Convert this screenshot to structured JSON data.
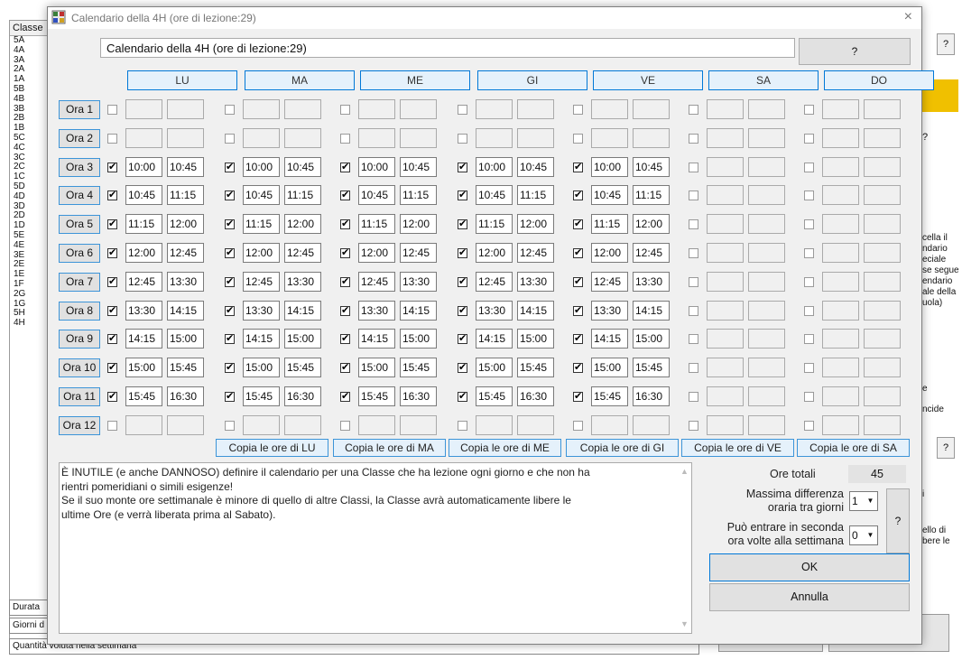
{
  "background": {
    "left_panel_header": "Classe",
    "classes": [
      "5A",
      "4A",
      "3A",
      "2A",
      "1A",
      "5B",
      "4B",
      "3B",
      "2B",
      "1B",
      "5C",
      "4C",
      "3C",
      "2C",
      "1C",
      "5D",
      "4D",
      "3D",
      "2D",
      "1D",
      "5E",
      "4E",
      "3E",
      "2E",
      "1E",
      "1F",
      "2G",
      "1G",
      "5H",
      "4H"
    ],
    "durata_label": "Durata",
    "giorni_label": "Giorni d",
    "quantita_label": "Quantità voluta nella settimana",
    "right_q1": "?",
    "right_q2": "?",
    "right_q3": "?",
    "right_text_lines": [
      "cella il",
      "ndario",
      "eciale",
      "se segue",
      "endario",
      "ale della",
      "uola)"
    ],
    "right_e": "e",
    "right_ncide": "ncide",
    "right_i": "i",
    "right_ello": "ello di",
    "right_bere": "bere le",
    "right_e2": "e",
    "accent_yellow": "#f0c000"
  },
  "dialog": {
    "title": "Calendario della 4H  (ore di lezione:29)",
    "close_glyph": "×",
    "calendar_label": "Calendario della 4H  (ore di lezione:29)",
    "help_label": "?",
    "days": [
      "LU",
      "MA",
      "ME",
      "GI",
      "VE",
      "SA",
      "DO"
    ],
    "hours": [
      {
        "label": "Ora 1",
        "checked": [
          false,
          false,
          false,
          false,
          false,
          false,
          false
        ],
        "start": "",
        "end": ""
      },
      {
        "label": "Ora 2",
        "checked": [
          false,
          false,
          false,
          false,
          false,
          false,
          false
        ],
        "start": "",
        "end": ""
      },
      {
        "label": "Ora 3",
        "checked": [
          true,
          true,
          true,
          true,
          true,
          false,
          false
        ],
        "start": "10:00",
        "end": "10:45"
      },
      {
        "label": "Ora 4",
        "checked": [
          true,
          true,
          true,
          true,
          true,
          false,
          false
        ],
        "start": "10:45",
        "end": "11:15"
      },
      {
        "label": "Ora 5",
        "checked": [
          true,
          true,
          true,
          true,
          true,
          false,
          false
        ],
        "start": "11:15",
        "end": "12:00"
      },
      {
        "label": "Ora 6",
        "checked": [
          true,
          true,
          true,
          true,
          true,
          false,
          false
        ],
        "start": "12:00",
        "end": "12:45"
      },
      {
        "label": "Ora 7",
        "checked": [
          true,
          true,
          true,
          true,
          true,
          false,
          false
        ],
        "start": "12:45",
        "end": "13:30"
      },
      {
        "label": "Ora 8",
        "checked": [
          true,
          true,
          true,
          true,
          true,
          false,
          false
        ],
        "start": "13:30",
        "end": "14:15"
      },
      {
        "label": "Ora 9",
        "checked": [
          true,
          true,
          true,
          true,
          true,
          false,
          false
        ],
        "start": "14:15",
        "end": "15:00"
      },
      {
        "label": "Ora 10",
        "checked": [
          true,
          true,
          true,
          true,
          true,
          false,
          false
        ],
        "start": "15:00",
        "end": "15:45"
      },
      {
        "label": "Ora 11",
        "checked": [
          true,
          true,
          true,
          true,
          true,
          false,
          false
        ],
        "start": "15:45",
        "end": "16:30"
      },
      {
        "label": "Ora 12",
        "checked": [
          false,
          false,
          false,
          false,
          false,
          false,
          false
        ],
        "start": "",
        "end": ""
      }
    ],
    "copy_buttons": [
      "Copia le ore di LU",
      "Copia le ore di MA",
      "Copia le ore di ME",
      "Copia le ore di GI",
      "Copia le ore di VE",
      "Copia le ore di SA"
    ],
    "note_lines": [
      "È INUTILE (e anche DANNOSO) definire il calendario per una Classe che ha lezione ogni giorno e che non ha",
      "rientri pomeridiani o simili esigenze!",
      "Se il suo monte ore settimanale è minore di quello di altre Classi, la Classe avrà automaticamente libere le",
      "ultime Ore (e verrà liberata prima al Sabato)."
    ],
    "ore_totali_label": "Ore totali",
    "ore_totali_value": "45",
    "max_diff_label_1": "Massima differenza",
    "max_diff_label_2": "oraria tra giorni",
    "max_diff_value": "1",
    "entrare_label_1": "Può entrare in seconda",
    "entrare_label_2": "ora volte alla settimana",
    "entrare_value": "0",
    "side_help": "?",
    "ok_label": "OK",
    "annulla_label": "Annulla"
  }
}
